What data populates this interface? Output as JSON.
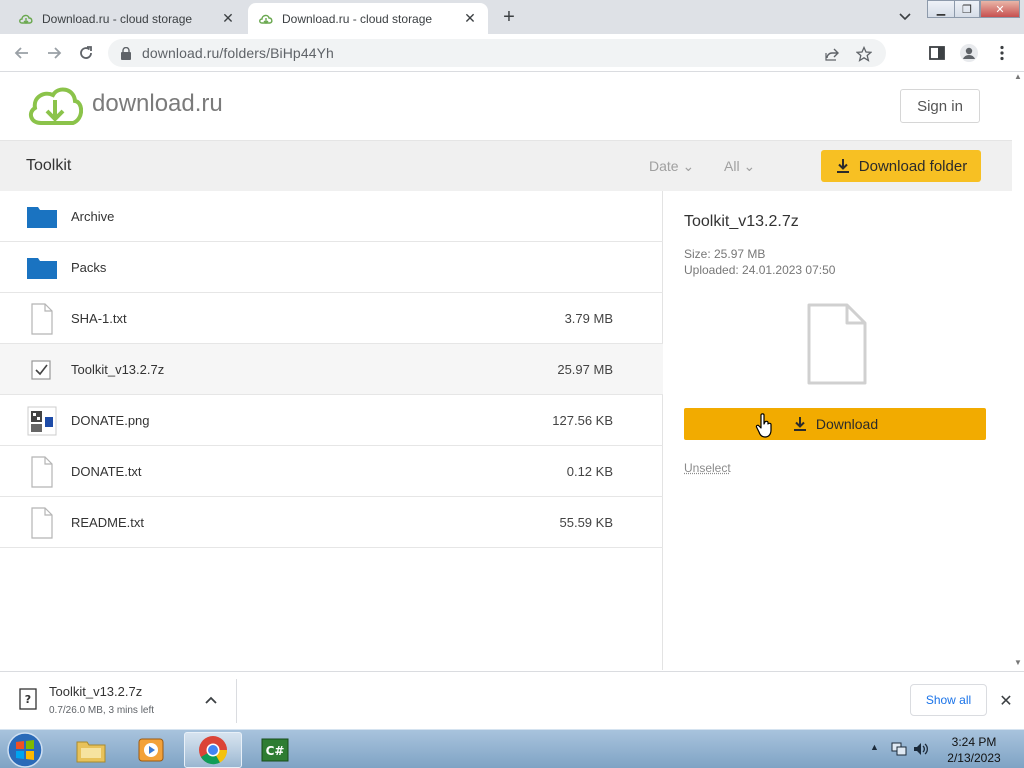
{
  "browser": {
    "tabs": [
      {
        "title": "Download.ru - cloud storage",
        "active": false
      },
      {
        "title": "Download.ru - cloud storage",
        "active": true
      }
    ],
    "url": "download.ru/folders/BiHp44Yh"
  },
  "site": {
    "brand": "download.ru",
    "signin_label": "Sign in"
  },
  "toolbar": {
    "folder_name": "Toolkit",
    "filter_date": "Date",
    "filter_all": "All",
    "download_folder_label": "Download folder"
  },
  "files": [
    {
      "name": "Archive",
      "size": "",
      "type": "folder"
    },
    {
      "name": "Packs",
      "size": "",
      "type": "folder"
    },
    {
      "name": "SHA-1.txt",
      "size": "3.79 MB",
      "type": "file"
    },
    {
      "name": "Toolkit_v13.2.7z",
      "size": "25.97 MB",
      "type": "selected"
    },
    {
      "name": "DONATE.png",
      "size": "127.56 KB",
      "type": "image"
    },
    {
      "name": "DONATE.txt",
      "size": "0.12 KB",
      "type": "file"
    },
    {
      "name": "README.txt",
      "size": "55.59 KB",
      "type": "file"
    }
  ],
  "details": {
    "title": "Toolkit_v13.2.7z",
    "size": "Size: 25.97 MB",
    "uploaded": "Uploaded: 24.01.2023 07:50",
    "download_label": "Download",
    "unselect_label": "Unselect"
  },
  "download_shelf": {
    "filename": "Toolkit_v13.2.7z",
    "status": "0.7/26.0 MB, 3 mins left",
    "show_all_label": "Show all"
  },
  "taskbar": {
    "time": "3:24 PM",
    "date": "2/13/2023"
  },
  "colors": {
    "accent_yellow": "#f7c023",
    "download_orange": "#f2ab00",
    "folder_blue": "#1a73c1",
    "brand_green": "#8bc34a"
  }
}
